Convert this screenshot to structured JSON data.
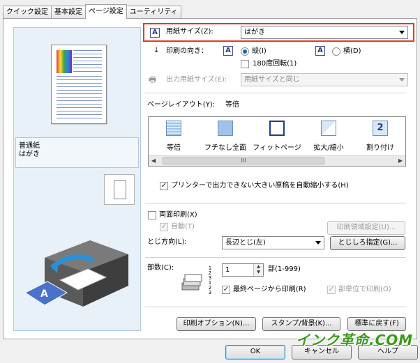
{
  "tabs": [
    "クイック設定",
    "基本設定",
    "ページ設定",
    "ユーティリティ"
  ],
  "left": {
    "media_line1": "普通紙",
    "media_line2": "はがき"
  },
  "paper_size": {
    "label": "用紙サイズ(Z):",
    "value": "はがき"
  },
  "orientation": {
    "label": "印刷の向き：",
    "portrait": "縦(I)",
    "landscape": "横(D)",
    "rotate180": "180度回転(1)"
  },
  "output_paper": {
    "label": "出力用紙サイズ(E):",
    "value": "用紙サイズと同じ"
  },
  "page_layout": {
    "label": "ページレイアウト(Y):",
    "value": "等倍",
    "items": [
      "等倍",
      "フチなし全面",
      "フィットページ",
      "拡大/縮小",
      "割り付け"
    ],
    "scroll_thumb": "III"
  },
  "auto_reduce": "プリンターで出力できない大きい原稿を自動縮小する(H)",
  "duplex": {
    "label": "両面印刷(X)",
    "auto": "自動(T)",
    "area_button": "印刷領域設定(U)...",
    "binding_label": "とじ方向(L):",
    "binding_value": "長辺とじ(左)",
    "margin_button": "とじしろ指定(G)..."
  },
  "copies": {
    "label": "部数(C):",
    "value": "1",
    "range": "部(1-999)",
    "reverse": "最終ページから印刷(R)",
    "collate": "部単位で印刷(O)"
  },
  "buttons": {
    "print_options": "印刷オプション(N)...",
    "stamp": "スタンプ/背景(K)...",
    "defaults": "標準に戻す(F)",
    "ok": "OK",
    "cancel": "キャンセル",
    "help": "ヘルプ"
  },
  "watermark": "インク革命.COM",
  "colors": {
    "highlight": "#e53a1e",
    "accent": "#1a5fb4",
    "watermark": "#3b9a1a"
  }
}
